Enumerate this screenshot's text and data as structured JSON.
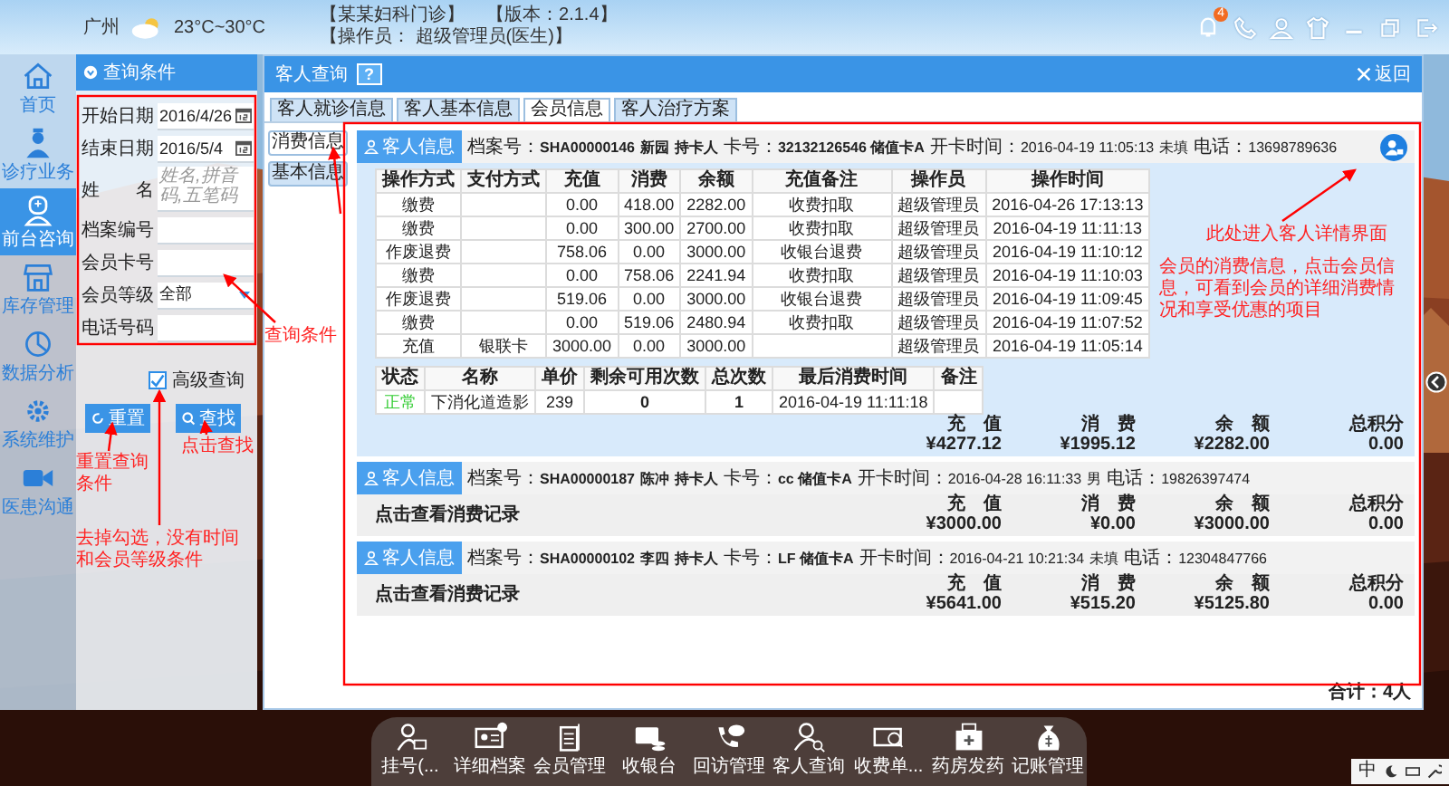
{
  "header": {
    "city": "广州",
    "weather": "23°C~30°C",
    "clinic": "【某某妇科门诊】",
    "version": "【版本：2.1.4】",
    "operator": "【操作员： 超级管理员(医生)】",
    "notice_count": "4"
  },
  "nav": [
    {
      "label": "首页",
      "selected": false
    },
    {
      "label": "诊疗业务",
      "selected": false
    },
    {
      "label": "前台咨询",
      "selected": true
    },
    {
      "label": "库存管理",
      "selected": false
    },
    {
      "label": "数据分析",
      "selected": false
    },
    {
      "label": "系统维护",
      "selected": false
    },
    {
      "label": "医患沟通",
      "selected": false
    }
  ],
  "query": {
    "title": "查询条件",
    "fields": [
      {
        "kind": "date",
        "label": "开始日期",
        "value": "2016/4/26"
      },
      {
        "kind": "date",
        "label": "结束日期",
        "value": "2016/5/4"
      },
      {
        "kind": "name",
        "label": "姓　　名",
        "placeholder": "姓名,拼音码,五笔码"
      },
      {
        "kind": "text",
        "label": "档案编号"
      },
      {
        "kind": "text",
        "label": "会员卡号"
      },
      {
        "kind": "select",
        "label": "会员等级",
        "value": "全部"
      },
      {
        "kind": "text",
        "label": "电话号码"
      }
    ],
    "advanced": {
      "label": "高级查询",
      "checked": true
    },
    "buttons": [
      {
        "kind": "reset",
        "label": "重置"
      },
      {
        "kind": "search",
        "label": "查找"
      }
    ]
  },
  "main": {
    "title": "客人查询",
    "help": "?",
    "back": "返回",
    "tabs": [
      {
        "label": "客人就诊信息",
        "selected": false
      },
      {
        "label": "客人基本信息",
        "selected": false
      },
      {
        "label": "会员信息",
        "selected": true
      },
      {
        "label": "客人治疗方案",
        "selected": false
      }
    ],
    "subtabs": [
      {
        "label": "消费信息",
        "selected": true
      },
      {
        "label": "基本信息",
        "selected": false
      }
    ],
    "records": [
      {
        "button": "客人信息",
        "expanded": true,
        "detail_link": true,
        "info": [
          {
            "label": "档案号：",
            "value": "SHA00000146"
          },
          {
            "value": "新园"
          },
          {
            "value": "持卡人"
          },
          {
            "label": "卡号：",
            "value": "32132126546 储值卡A"
          },
          {
            "label": "开卡时间：",
            "plain": "2016-04-19 11:05:13"
          },
          {
            "plain": "未填"
          },
          {
            "label": "电话：",
            "plain": "13698789636"
          }
        ],
        "transactions": {
          "columns": [
            "操作方式",
            "支付方式",
            "充值",
            "消费",
            "余额",
            "充值备注",
            "操作员",
            "操作时间"
          ],
          "rows": [
            {
              "op": "缴费",
              "charge": "0.00",
              "spend": "418.00",
              "balance": "2282.00",
              "note": "收费扣取",
              "operator": "超级管理员",
              "time": "2016-04-26 17:13:13"
            },
            {
              "op": "缴费",
              "charge": "0.00",
              "spend": "300.00",
              "balance": "2700.00",
              "note": "收费扣取",
              "operator": "超级管理员",
              "time": "2016-04-19 11:11:13"
            },
            {
              "op": "作废退费",
              "charge": "758.06",
              "spend": "0.00",
              "balance": "3000.00",
              "note": "收银台退费",
              "operator": "超级管理员",
              "time": "2016-04-19 11:10:12"
            },
            {
              "op": "缴费",
              "charge": "0.00",
              "spend": "758.06",
              "balance": "2241.94",
              "note": "收费扣取",
              "operator": "超级管理员",
              "time": "2016-04-19 11:10:03"
            },
            {
              "op": "作废退费",
              "charge": "519.06",
              "spend": "0.00",
              "balance": "3000.00",
              "note": "收银台退费",
              "operator": "超级管理员",
              "time": "2016-04-19 11:09:45"
            },
            {
              "op": "缴费",
              "charge": "0.00",
              "spend": "519.06",
              "balance": "2480.94",
              "note": "收费扣取",
              "operator": "超级管理员",
              "time": "2016-04-19 11:07:52"
            },
            {
              "op": "充值",
              "pay": "银联卡",
              "charge": "3000.00",
              "spend": "0.00",
              "balance": "3000.00",
              "operator": "超级管理员",
              "time": "2016-04-19 11:05:14"
            }
          ]
        },
        "usage": {
          "columns": [
            "状态",
            "名称",
            "单价",
            "剩余可用次数",
            "总次数",
            "最后消费时间",
            "备注"
          ],
          "rows": [
            {
              "status": "正常",
              "color": "#33cc33",
              "name": "下消化道造影",
              "price": "239",
              "remaining": "0",
              "total": "1",
              "last": "2016-04-19 11:11:18"
            }
          ]
        },
        "totals": [
          {
            "label": "充　值",
            "value": "¥4277.12"
          },
          {
            "label": "消　费",
            "value": "¥1995.12"
          },
          {
            "label": "余　额",
            "value": "¥2282.00"
          },
          {
            "label": "总积分",
            "value": "0.00"
          }
        ]
      },
      {
        "button": "客人信息",
        "expanded": false,
        "detail_link": false,
        "info": [
          {
            "label": "档案号：",
            "value": "SHA00000187"
          },
          {
            "value": "陈冲"
          },
          {
            "value": "持卡人"
          },
          {
            "label": "卡号：",
            "value": "cc 储值卡A"
          },
          {
            "label": "开卡时间：",
            "plain": "2016-04-28 16:11:33"
          },
          {
            "plain": "男"
          },
          {
            "label": "电话：",
            "plain": "19826397474"
          }
        ],
        "view_link": "点击查看消费记录",
        "totals": [
          {
            "label": "充　值",
            "value": "¥3000.00"
          },
          {
            "label": "消　费",
            "value": "¥0.00"
          },
          {
            "label": "余　额",
            "value": "¥3000.00"
          },
          {
            "label": "总积分",
            "value": "0.00"
          }
        ]
      },
      {
        "button": "客人信息",
        "expanded": false,
        "detail_link": false,
        "info": [
          {
            "label": "档案号：",
            "value": "SHA00000102"
          },
          {
            "value": "李四"
          },
          {
            "value": "持卡人"
          },
          {
            "label": "卡号：",
            "value": "LF 储值卡A"
          },
          {
            "label": "开卡时间：",
            "plain": "2016-04-21 10:21:34"
          },
          {
            "plain": "未填"
          },
          {
            "label": "电话：",
            "plain": "12304847766"
          }
        ],
        "view_link": "点击查看消费记录",
        "totals": [
          {
            "label": "充　值",
            "value": "¥5641.00"
          },
          {
            "label": "消　费",
            "value": "¥515.20"
          },
          {
            "label": "余　额",
            "value": "¥5125.80"
          },
          {
            "label": "总积分",
            "value": "0.00"
          }
        ]
      }
    ],
    "footer": "合计：4人"
  },
  "annotations": [
    "查询条件",
    "此处进入客人详情界面",
    "会员的消费信息，点击会员信息，可看到会员的详细消费情况和享受优惠的项目",
    "重置查询条件",
    "点击查找",
    "去掉勾选，没有时间和会员等级条件"
  ],
  "dock": [
    {
      "label": "挂号(..."
    },
    {
      "label": "详细档案"
    },
    {
      "label": "会员管理"
    },
    {
      "label": "收银台"
    },
    {
      "label": "回访管理"
    },
    {
      "label": "客人查询"
    },
    {
      "label": "收费单..."
    },
    {
      "label": "药房发药"
    },
    {
      "label": "记账管理"
    }
  ],
  "tray": {
    "ime": "中"
  }
}
